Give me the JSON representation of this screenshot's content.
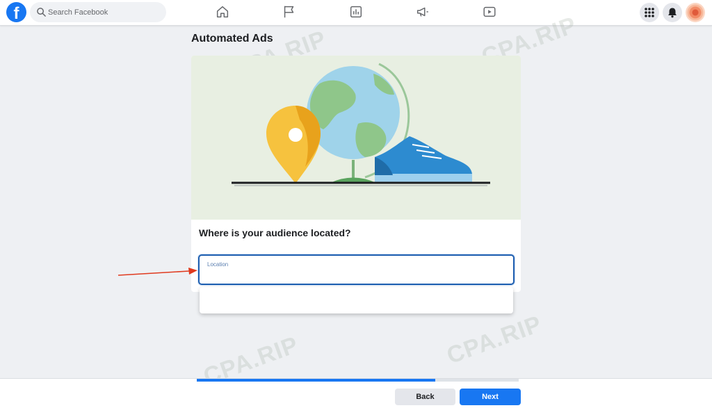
{
  "topbar": {
    "logo_letter": "f",
    "search_placeholder": "Search Facebook",
    "nav_icons": [
      "home-icon",
      "pages-flag-icon",
      "ads-manager-chart-icon",
      "megaphone-icon",
      "video-icon"
    ],
    "right_icons": [
      "grid-menu-icon",
      "notifications-bell-icon",
      "avatar"
    ]
  },
  "page": {
    "title": "Automated Ads",
    "question": "Where is your audience located?",
    "location_label": "Location",
    "location_value": ""
  },
  "progress": {
    "fraction": 0.74
  },
  "footer": {
    "back_label": "Back",
    "next_label": "Next"
  },
  "watermark": {
    "text": "CPA.RIP"
  },
  "colors": {
    "brand": "#1877f2",
    "focus_border": "#1f5fb0",
    "illustration_bg": "#e8efe2",
    "annotation_arrow": "#e03a1e"
  }
}
